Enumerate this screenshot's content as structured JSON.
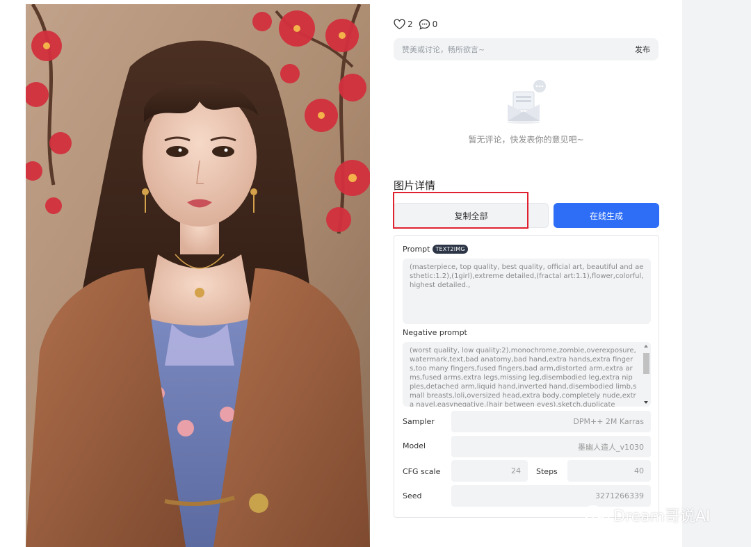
{
  "reactions": {
    "likes": "2",
    "comments": "0"
  },
  "comment": {
    "placeholder": "赞美或讨论，畅所欲言~",
    "publish_label": "发布"
  },
  "empty_state": {
    "text": "暂无评论，快发表你的意见吧~"
  },
  "details": {
    "title": "图片详情",
    "copy_all_label": "复制全部",
    "generate_label": "在线生成",
    "prompt_label": "Prompt",
    "prompt_tag": "TEXT2IMG",
    "prompt_text": "(masterpiece, top quality, best quality, official art, beautiful and aesthetic:1.2),(1girl),extreme detailed,(fractal art:1.1),flower,colorful,highest detailed.,",
    "negative_label": "Negative prompt",
    "negative_text": "(worst quality, low quality:2),monochrome,zombie,overexposure,watermark,text,bad anatomy,bad hand,extra hands,extra fingers,too many fingers,fused fingers,bad arm,distorted arm,extra arms,fused arms,extra legs,missing leg,disembodied leg,extra nipples,detached arm,liquid hand,inverted hand,disembodied limb,small breasts,loli,oversized head,extra body,completely nude,extra navel,easynegative,(hair between eyes),sketch,duplicate",
    "sampler_label": "Sampler",
    "sampler_value": "DPM++ 2M Karras",
    "model_label": "Model",
    "model_value": "墨幽人造人_v1030",
    "cfg_label": "CFG scale",
    "cfg_value": "24",
    "steps_label": "Steps",
    "steps_value": "40",
    "seed_label": "Seed",
    "seed_value": "3271266339"
  },
  "watermark": {
    "text": "Dream哥说AI"
  },
  "colors": {
    "accent": "#2e6ef7",
    "highlight": "#e0202e",
    "field_bg": "#f2f3f5"
  }
}
